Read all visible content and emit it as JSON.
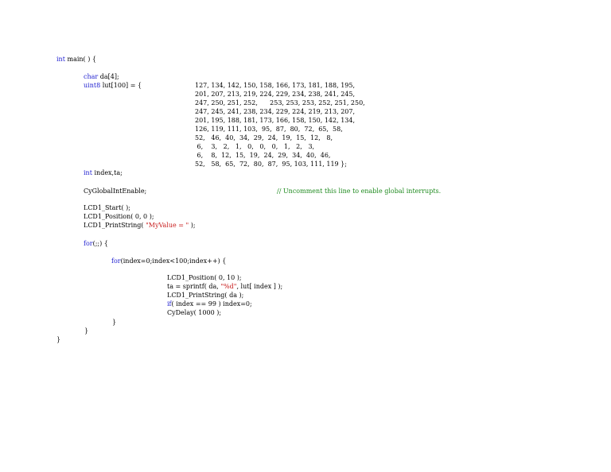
{
  "colors": {
    "keyword": "#1f1fd0",
    "string": "#c81e1e",
    "comment": "#1e8a1e",
    "text": "#000000"
  },
  "code": {
    "main_kw": "int",
    "main_rest": " main( ) {",
    "char_kw": "char",
    "char_rest": " da[4];",
    "uint8_kw": "uint8",
    "uint8_rest": " lut[100] = {",
    "lut_rows": [
      "127, 134, 142, 150, 158, 166, 173, 181, 188, 195,",
      "201, 207, 213, 219, 224, 229, 234, 238, 241, 245,",
      "247, 250, 251, 252,      253, 253, 253, 252, 251, 250,",
      "247, 245, 241, 238, 234, 229, 224, 219, 213, 207,",
      "201, 195, 188, 181, 173, 166, 158, 150, 142, 134,",
      "126, 119, 111, 103,  95,  87,  80,  72,  65,  58,",
      "52,   46,  40,  34,  29,  24,  19,  15,  12,   8,",
      " 6,    3,   2,   1,   0,   0,   0,   1,   2,   3,",
      " 6,    8,  12,  15,  19,  24,  29,  34,  40,  46,",
      "52,   58,  65,  72,  80,  87,  95, 103, 111, 119 };"
    ],
    "int2_kw": "int",
    "int2_rest": " index,ta;",
    "cyglobal": "CyGlobalIntEnable;",
    "cyglobal_comment": "// Uncomment this line to enable global interrupts.",
    "lcd_start": "LCD1_Start( );",
    "lcd_position": "LCD1_Position( 0, 0 );",
    "lcd_print_pre": "LCD1_PrintString( ",
    "lcd_print_str": "\"MyValue = \"",
    "lcd_print_post": " );",
    "for1_kw": "for",
    "for1_rest": "(;;) {",
    "for2_kw": "for",
    "for2_rest": "(index=0;index<100;index++) {",
    "in_position": "LCD1_Position( 0, 10 );",
    "sprintf_pre": "ta = sprintf( da, ",
    "sprintf_str": "\"%d\"",
    "sprintf_post": ", lut[ index ] );",
    "in_print": "LCD1_PrintString( da );",
    "if_kw": "if",
    "if_rest": "( index == 99 ) index=0;",
    "cydelay": "CyDelay( 1000 );",
    "close_for2": "}",
    "close_for1": "}",
    "close_main": "}"
  }
}
